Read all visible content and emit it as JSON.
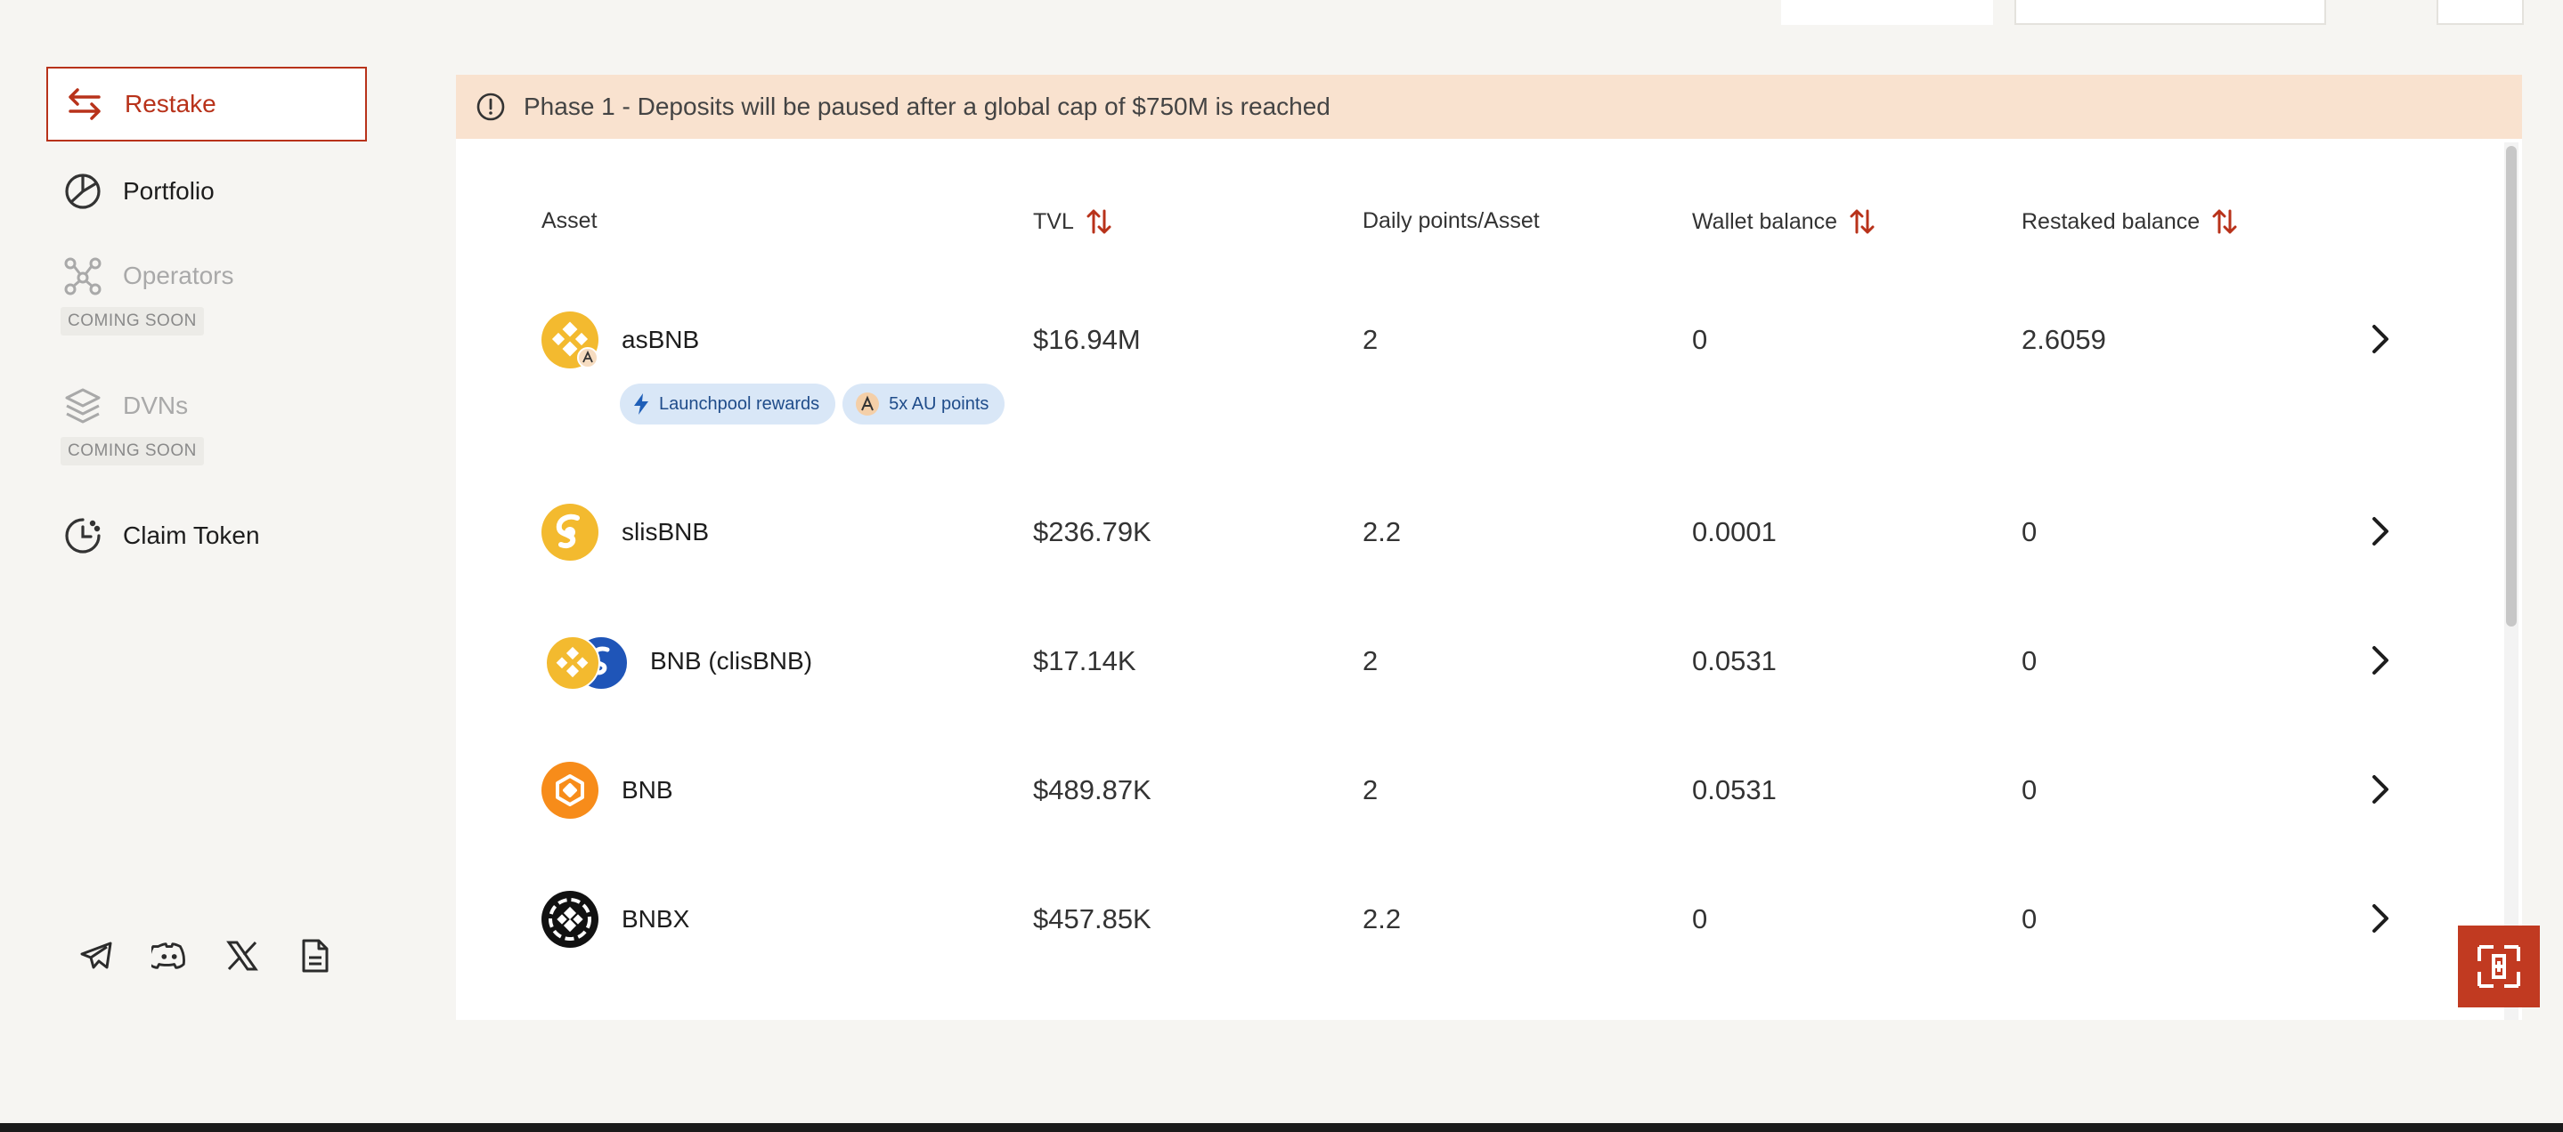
{
  "sidebar": {
    "items": [
      {
        "label": "Restake",
        "icon": "swap-arrows-icon",
        "state": "active"
      },
      {
        "label": "Portfolio",
        "icon": "pie-chart-icon",
        "state": "normal"
      },
      {
        "label": "Operators",
        "icon": "network-icon",
        "state": "disabled",
        "badge": "COMING SOON"
      },
      {
        "label": "DVNs",
        "icon": "layers-icon",
        "state": "disabled",
        "badge": "COMING SOON"
      },
      {
        "label": "Claim Token",
        "icon": "claim-clock-icon",
        "state": "normal"
      }
    ],
    "social": [
      "telegram-icon",
      "discord-icon",
      "x-icon",
      "document-icon"
    ]
  },
  "banner": {
    "text": "Phase 1 - Deposits will be paused after a global cap of $750M is reached",
    "icon": "alert-circle-icon"
  },
  "table": {
    "headers": {
      "asset": "Asset",
      "tvl": "TVL",
      "daily": "Daily points/Asset",
      "wallet": "Wallet balance",
      "restaked": "Restaked balance"
    },
    "rows": [
      {
        "name": "asBNB",
        "tvl": "$16.94M",
        "daily": "2",
        "wallet": "0",
        "restaked": "2.6059",
        "badges": [
          "Launchpool rewards",
          "5x AU points"
        ]
      },
      {
        "name": "slisBNB",
        "tvl": "$236.79K",
        "daily": "2.2",
        "wallet": "0.0001",
        "restaked": "0"
      },
      {
        "name": "BNB (clisBNB)",
        "tvl": "$17.14K",
        "daily": "2",
        "wallet": "0.0531",
        "restaked": "0"
      },
      {
        "name": "BNB",
        "tvl": "$489.87K",
        "daily": "2",
        "wallet": "0.0531",
        "restaked": "0"
      },
      {
        "name": "BNBX",
        "tvl": "$457.85K",
        "daily": "2.2",
        "wallet": "0",
        "restaked": "0"
      }
    ]
  },
  "colors": {
    "accent": "#b8321a",
    "banner_bg": "#f9e2cf",
    "badge_bg": "#d9e7f7",
    "bnb_yellow": "#f3ba2f"
  }
}
